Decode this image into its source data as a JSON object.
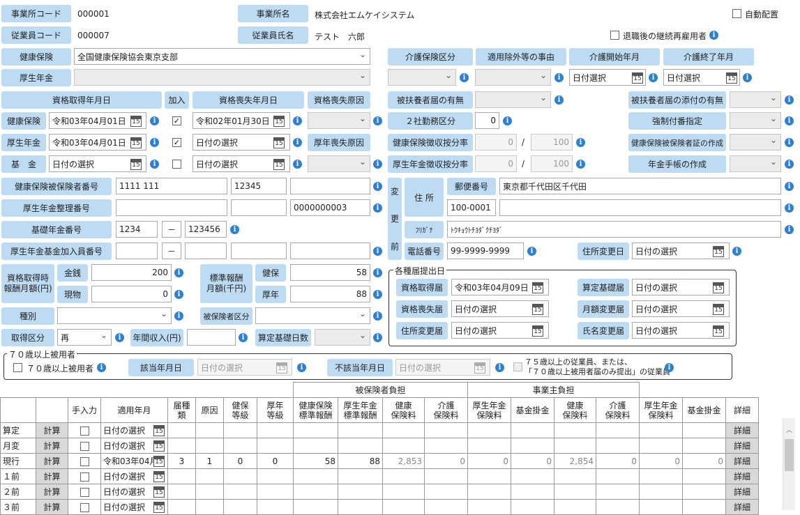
{
  "top": {
    "office_code_label": "事業所コード",
    "office_code": "000001",
    "office_name_label": "事業所名",
    "office_name": "株式会社エムケイシステム",
    "auto_place": "自動配置",
    "emp_code_label": "従業員コード",
    "emp_code": "000007",
    "emp_name_label": "従業員氏名",
    "emp_name": "テスト　六郎",
    "rehire": "退職後の継続再雇用者"
  },
  "ins": {
    "health_label": "健康保険",
    "health_value": "全国健康保険協会東京支部",
    "pension_label": "厚生年金",
    "care_div": "介護保険区分",
    "exempt_reason": "適用除外等の事由",
    "care_start": "介護開始年月",
    "care_end": "介護終了年月",
    "date_select": "日付選択"
  },
  "qual": {
    "acq_date": "資格取得年月日",
    "join": "加入",
    "loss_date": "資格喪失年月日",
    "loss_reason": "資格喪失原因",
    "health": "健康保険",
    "pension": "厚生年金",
    "fund": "基　金",
    "h_acq": "令和03年04月01日",
    "p_acq": "令和03年04月01日",
    "f_acq": "日付の選択",
    "h_loss": "令和02年01月30日",
    "p_loss": "日付の選択",
    "f_loss": "日付の選択",
    "pension_loss_reason": "厚年喪失原因",
    "dep_notice": "被扶養者届の有無",
    "dep_attach": "被扶養者届の添付の有無",
    "two_work": "２社勤務区分",
    "two_work_value": "0",
    "forced_num": "強制付番指定",
    "h_ratio": "健康保険徴収按分率",
    "p_ratio": "厚生年金徴収按分率",
    "zero": "0",
    "hundred": "100",
    "slash": "/",
    "h_card": "健康保険被保険者証の作成",
    "p_book": "年金手帳の作成"
  },
  "numbers": {
    "h_insured": "健康保険被保険者番号",
    "h_insured_1": "1111 111",
    "h_insured_2": "12345",
    "p_org": "厚生年金整理番号",
    "p_org_3": "0000000003",
    "basic": "基礎年金番号",
    "basic_1": "1234",
    "basic_2": "123456",
    "dash": "－",
    "fund_member": "厚生年金基金加入員番号"
  },
  "address": {
    "change": [
      "変",
      "更",
      "前"
    ],
    "addr": "住 所",
    "zip_label": "郵便番号",
    "zip": "100-0001",
    "addr1": "東京都千代田区千代田",
    "kana_label": "ﾌﾘｶﾞﾅ",
    "kana": "ﾄｳｷｮｳﾄﾁﾖﾀﾞｸﾁﾖﾀﾞ",
    "phone_label": "電話番号",
    "phone": "99-9999-9999",
    "addr_change": "住所変更日",
    "addr_change_val": "日付の選択"
  },
  "pay": {
    "acq_pay": "資格取得時\n報酬月額(円)",
    "cash": "金銭",
    "cash_val": "200",
    "goods": "現物",
    "goods_val": "0",
    "std": "標準報酬\n月額(千円)",
    "kenpo": "健保",
    "kenpo_val": "58",
    "kounen": "厚年",
    "kounen_val": "88",
    "kind": "種別",
    "insured_div": "被保険者区分",
    "acq_div": "取得区分",
    "acq_div_val": "再",
    "annual": "年間収入(円)",
    "calc_days": "算定基礎日数"
  },
  "notices": {
    "title": "各種届提出日",
    "acq": "資格取得届",
    "acq_val": "令和03年04月09日",
    "loss": "資格喪失届",
    "loss_val": "日付の選択",
    "addr": "住所変更届",
    "addr_val": "日付の選択",
    "calc": "算定基礎届",
    "calc_val": "日付の選択",
    "monthly": "月額変更届",
    "monthly_val": "日付の選択",
    "name": "氏名変更届",
    "name_val": "日付の選択"
  },
  "over70": {
    "title": "７０歳以上被用者",
    "check": "７０歳以上被用者",
    "applic": "該当年月日",
    "applic_val": "日付の選択",
    "nonapplic": "不該当年月日",
    "nonapplic_val": "日付の選択",
    "note": "７５歳以上の従業員、または、\n「７０歳以上被用者届のみ提出」の従業員"
  },
  "table": {
    "group1": "被保険者負担",
    "group2": "事業主負担",
    "headers": [
      "手入力",
      "適用年月",
      "届種類",
      "原因",
      "健保\n等級",
      "厚年\n等級",
      "健康保険\n標準報酬",
      "厚生年金\n標準報酬",
      "健康\n保険料",
      "介護\n保険料",
      "厚生年金\n保険料",
      "基金掛金",
      "健康\n保険料",
      "介護\n保険料",
      "厚生年金\n保険料",
      "基金掛金",
      "詳細"
    ],
    "rows": [
      {
        "label": "算定",
        "calc": "計算",
        "date": "日付の選択",
        "kind": "",
        "reason": "",
        "hg": "",
        "pg": "",
        "hs": "",
        "ps": "",
        "e1": "",
        "e2": "",
        "e3": "",
        "e4": "",
        "r1": "",
        "r2": "",
        "r3": "",
        "r4": "",
        "detail": "詳細"
      },
      {
        "label": "月変",
        "calc": "計算",
        "date": "日付の選択",
        "kind": "",
        "reason": "",
        "hg": "",
        "pg": "",
        "hs": "",
        "ps": "",
        "e1": "",
        "e2": "",
        "e3": "",
        "e4": "",
        "r1": "",
        "r2": "",
        "r3": "",
        "r4": "",
        "detail": "詳細"
      },
      {
        "label": "現行",
        "calc": "計算",
        "date": "令和03年04月",
        "kind": "3",
        "reason": "1",
        "hg": "0",
        "pg": "0",
        "hs": "58",
        "ps": "88",
        "e1": "2,853",
        "e2": "0",
        "e3": "0",
        "e4": "0",
        "r1": "2,854",
        "r2": "0",
        "r3": "0",
        "r4": "0",
        "detail": "詳細"
      },
      {
        "label": "１前",
        "calc": "計算",
        "date": "日付の選択",
        "kind": "",
        "reason": "",
        "hg": "",
        "pg": "",
        "hs": "",
        "ps": "",
        "e1": "",
        "e2": "",
        "e3": "",
        "e4": "",
        "r1": "",
        "r2": "",
        "r3": "",
        "r4": "",
        "detail": "詳細"
      },
      {
        "label": "２前",
        "calc": "計算",
        "date": "日付の選択",
        "kind": "",
        "reason": "",
        "hg": "",
        "pg": "",
        "hs": "",
        "ps": "",
        "e1": "",
        "e2": "",
        "e3": "",
        "e4": "",
        "r1": "",
        "r2": "",
        "r3": "",
        "r4": "",
        "detail": "詳細"
      },
      {
        "label": "３前",
        "calc": "計算",
        "date": "日付の選択",
        "kind": "",
        "reason": "",
        "hg": "",
        "pg": "",
        "hs": "",
        "ps": "",
        "e1": "",
        "e2": "",
        "e3": "",
        "e4": "",
        "r1": "",
        "r2": "",
        "r3": "",
        "r4": "",
        "detail": "詳細"
      }
    ]
  }
}
